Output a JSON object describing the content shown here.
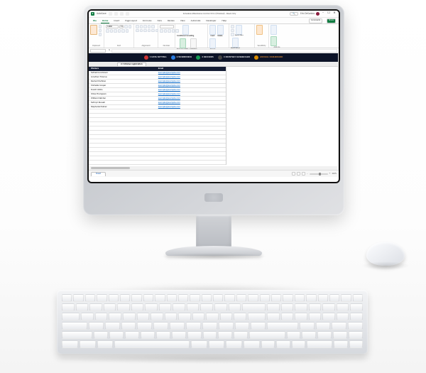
{
  "titlebar": {
    "autosave_label": "AutoSave",
    "doc_name": "Schedule Attendance Control V19.4 (finished) - Read-Only",
    "compat_label": "Saved",
    "search_placeholder": "Search",
    "user_name": "Eric DeSantos"
  },
  "tabs": {
    "file": "File",
    "home": "Home",
    "insert": "Insert",
    "page_layout": "Page Layout",
    "formulas": "Formulas",
    "data": "Data",
    "review": "Review",
    "view": "View",
    "automate": "Automate",
    "developer": "Developer",
    "help": "Help",
    "comments": "Comments",
    "share": "Share"
  },
  "ribbon": {
    "clipboard": "Clipboard",
    "font_group": "Font",
    "alignment": "Alignment",
    "number": "Number",
    "styles": "Styles",
    "cells": "Cells",
    "editing": "Editing",
    "analysis": "Sensitivity",
    "addins": "Add-ins",
    "paste": "Paste",
    "font_name": "Calibri",
    "font_size": "11",
    "cond_format": "Conditional Formatting",
    "format_table": "Format as Table",
    "cell_styles": "Cell Styles",
    "insert": "Insert",
    "delete": "Delete",
    "format": "Format",
    "sort_filter": "Sort & Filter",
    "find_select": "Find & Select",
    "analyze": "Analyze Data"
  },
  "formula_bar": {
    "name_box": "",
    "fx": "fx"
  },
  "nav": {
    "data_setting": "1 DATA SETTING",
    "workforce": "2 WORKFORCE",
    "records": "3 RECORDS",
    "monthly": "4 MONTHLY DASHBOARD",
    "annual": "ANNUAL DASHBOARD"
  },
  "section": {
    "title": "2.1 Worker registration"
  },
  "table": {
    "headers": {
      "workers": "Workers",
      "email": "Email"
    },
    "rows": [
      {
        "worker": "Katherine Johnson",
        "email": "example@example.com"
      },
      {
        "worker": "Jonathan Thomas",
        "email": "example@example.com"
      },
      {
        "worker": "Rachel Martinez",
        "email": "example@example.com"
      },
      {
        "worker": "Michelle Cooper",
        "email": "example@example.com"
      },
      {
        "worker": "David Collins",
        "email": "example@example.com"
      },
      {
        "worker": "Olivia Thompson",
        "email": "example@example.com"
      },
      {
        "worker": "William Fletcher",
        "email": "example@example.com"
      },
      {
        "worker": "Kathryn Russell",
        "email": "example@example.com"
      },
      {
        "worker": "Stephanie Palmer",
        "email": "example@example.com"
      }
    ]
  },
  "statusbar": {
    "sheet_tab": "Sheet",
    "zoom_minus": "−",
    "zoom_plus": "+",
    "zoom_value": "100%"
  }
}
